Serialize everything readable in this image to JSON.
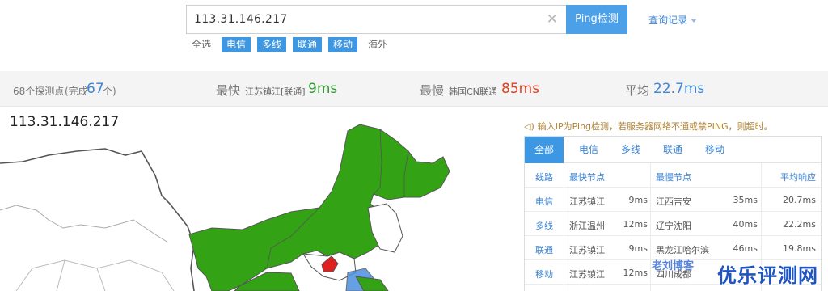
{
  "search": {
    "value": "113.31.146.217",
    "clear_icon": "close-icon",
    "button_label": "Ping检测",
    "history_label": "查询记录"
  },
  "filters": {
    "all_label": "全选",
    "telecom": "电信",
    "multi": "多线",
    "unicom": "联通",
    "mobile": "移动",
    "overseas": "海外"
  },
  "stats": {
    "nodes_text": "68个探测点",
    "done_prefix": "(完成",
    "done_count": "67",
    "done_suffix": "个)",
    "fastest_label": "最快",
    "fastest_node": "江苏镇江[联通]",
    "fastest_value": "9ms",
    "slowest_label": "最慢",
    "slowest_node": "韩国CN联通",
    "slowest_value": "85ms",
    "avg_label": "平均",
    "avg_value": "22.7ms"
  },
  "map": {
    "title": "113.31.146.217",
    "colors": {
      "fast": "#33a315",
      "slow": "#e02020",
      "border": "#555555",
      "blue": "#4b8fe0"
    }
  },
  "hint": {
    "icon": "speaker-icon",
    "text": "输入IP为Ping检测，若服务器网络不通或禁PING，则超时。"
  },
  "panel": {
    "tabs": [
      "全部",
      "电信",
      "多线",
      "联通",
      "移动"
    ],
    "headers": {
      "isp": "线路",
      "fastest": "最快节点",
      "slowest": "最慢节点",
      "avg": "平均响应"
    },
    "rows": [
      {
        "isp": "电信",
        "fast_node": "江苏镇江",
        "fast_time": "9ms",
        "slow_node": "江西吉安",
        "slow_time": "35ms",
        "avg": "20.7ms"
      },
      {
        "isp": "多线",
        "fast_node": "浙江温州",
        "fast_time": "12ms",
        "slow_node": "辽宁沈阳",
        "slow_time": "40ms",
        "avg": "22.2ms"
      },
      {
        "isp": "联通",
        "fast_node": "江苏镇江",
        "fast_time": "9ms",
        "slow_node": "黑龙江哈尔滨",
        "slow_time": "46ms",
        "avg": "19.8ms"
      },
      {
        "isp": "移动",
        "fast_node": "江苏镇江",
        "fast_time": "12ms",
        "slow_node": "四川成都",
        "slow_time": "",
        "avg": ""
      }
    ]
  },
  "watermark": {
    "main": "优乐评测网",
    "sub": "老刘博客"
  },
  "colors": {
    "accent": "#3e97e3",
    "fast_green": "#2f9a2f",
    "slow_red": "#e0401f",
    "avg_blue": "#3b86d6"
  }
}
